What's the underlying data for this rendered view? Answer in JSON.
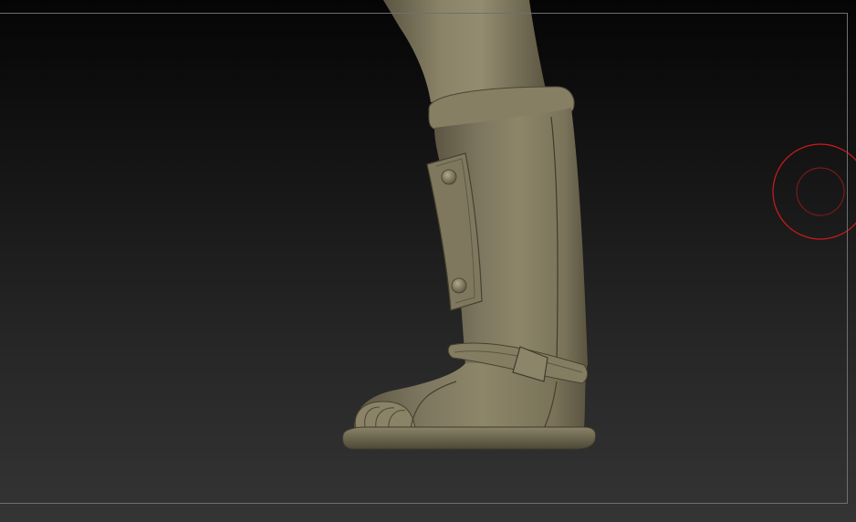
{
  "canvas": {
    "background_top": "#050505",
    "background_bottom": "#343434",
    "frame_color": "#6f6f6f"
  },
  "model": {
    "material_color": "#847d63",
    "highlight_color": "#a49c7d",
    "shadow_color": "#4b4636"
  },
  "brush": {
    "color": "#d11a1a",
    "inner_color": "#7a1a1a"
  }
}
